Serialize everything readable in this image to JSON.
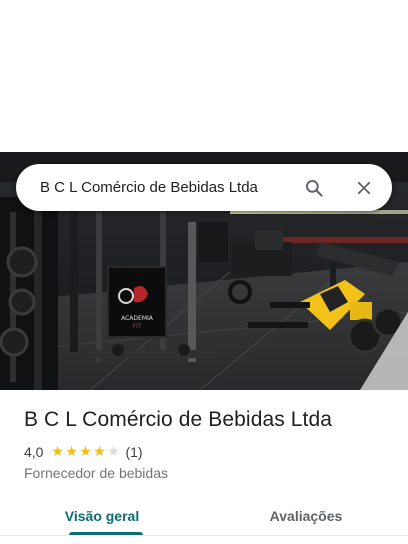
{
  "search": {
    "query": "B C L Comércio de Bebidas Ltda",
    "search_icon": "search-icon",
    "close_icon": "close-icon"
  },
  "hero": {
    "photo_sign_text": "ACADEMIA",
    "photo_sign_subtext": "FIT"
  },
  "place": {
    "name": "B C L Comércio de Bebidas Ltda",
    "rating": "4,0",
    "rating_value": 4,
    "rating_max": 5,
    "review_count": "(1)",
    "category": "Fornecedor de bebidas"
  },
  "tabs": [
    {
      "label": "Visão geral",
      "active": true
    },
    {
      "label": "Avaliações",
      "active": false
    }
  ],
  "colors": {
    "accent": "#0b6e74",
    "star": "#fbbc04",
    "star_empty": "#dadce0"
  }
}
